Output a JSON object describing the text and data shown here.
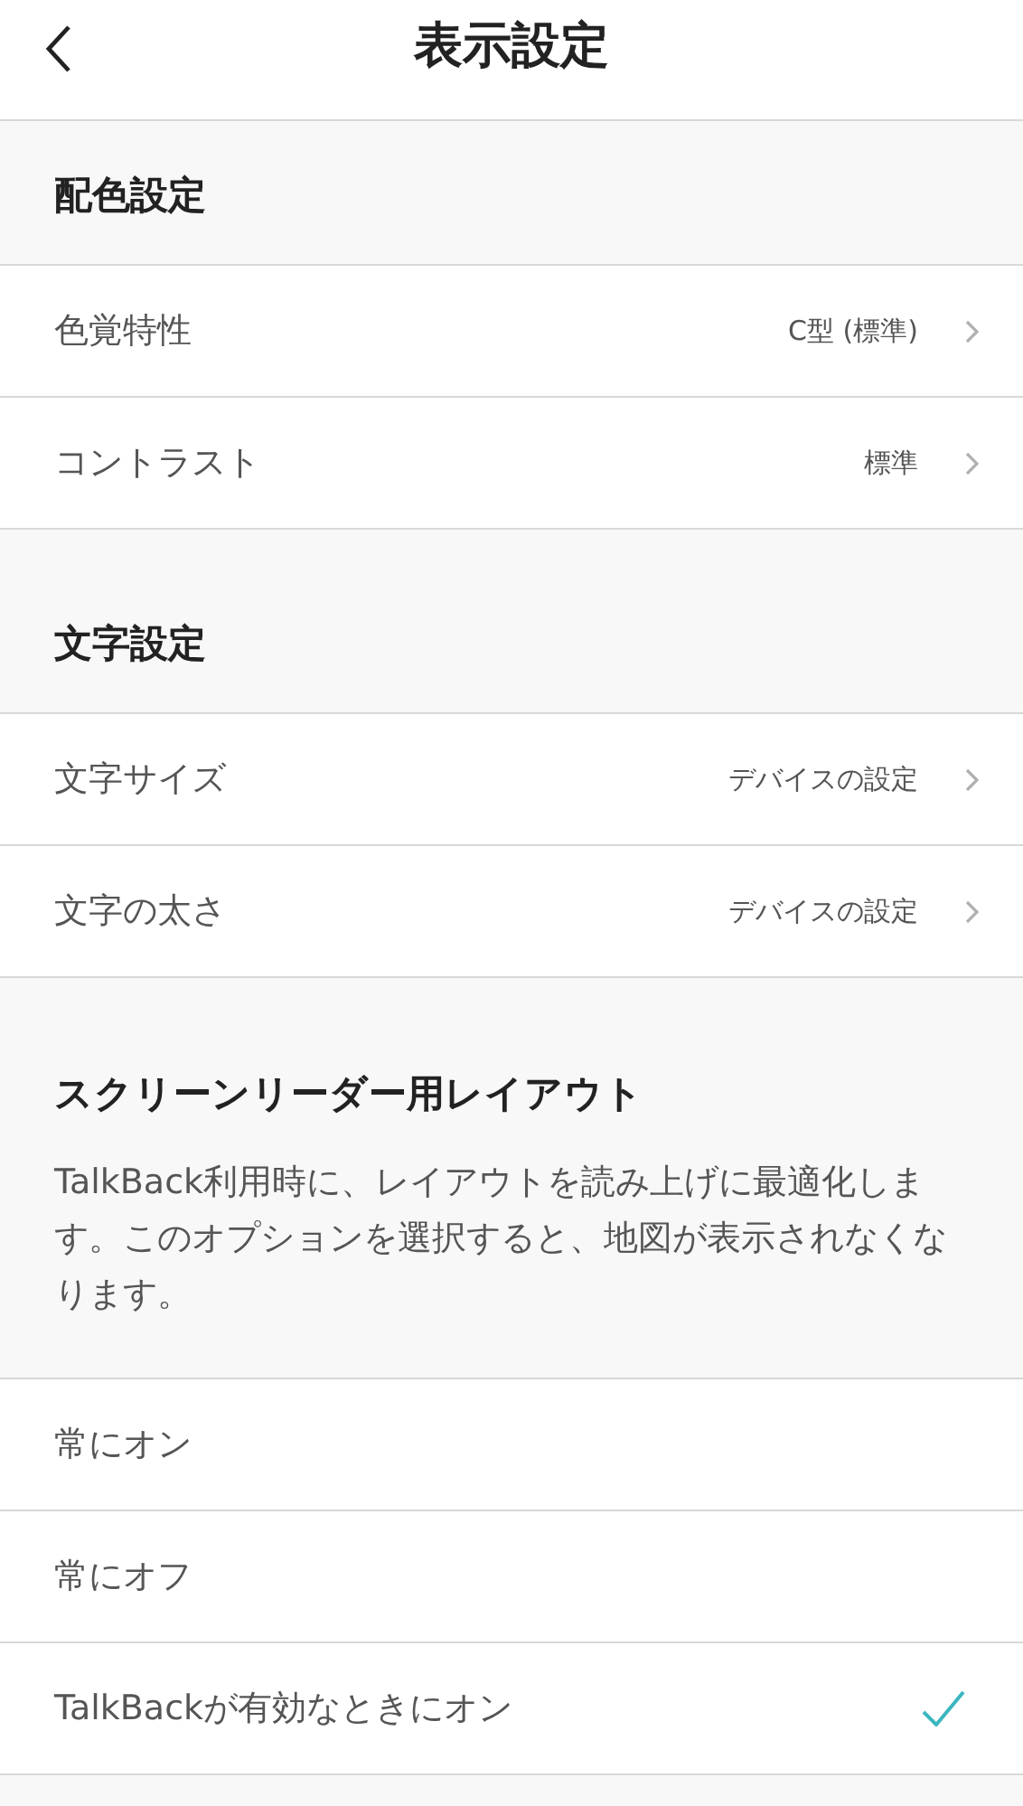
{
  "header": {
    "title": "表示設定"
  },
  "sections": [
    {
      "title": "配色設定",
      "items": [
        {
          "kind": "link",
          "label": "色覚特性",
          "value": "C型 (標準)"
        },
        {
          "kind": "link",
          "label": "コントラスト",
          "value": "標準"
        }
      ]
    },
    {
      "title": "文字設定",
      "items": [
        {
          "kind": "link",
          "label": "文字サイズ",
          "value": "デバイスの設定"
        },
        {
          "kind": "link",
          "label": "文字の太さ",
          "value": "デバイスの設定"
        }
      ]
    },
    {
      "title": "スクリーンリーダー用レイアウト",
      "description": "TalkBack利用時に、レイアウトを読み上げに最適化します。このオプションを選択すると、地図が表示されなくなります。",
      "items": [
        {
          "kind": "choice",
          "label": "常にオン",
          "selected": false
        },
        {
          "kind": "choice",
          "label": "常にオフ",
          "selected": false
        },
        {
          "kind": "choice",
          "label": "TalkBackが有効なときにオン",
          "selected": true
        }
      ]
    }
  ]
}
